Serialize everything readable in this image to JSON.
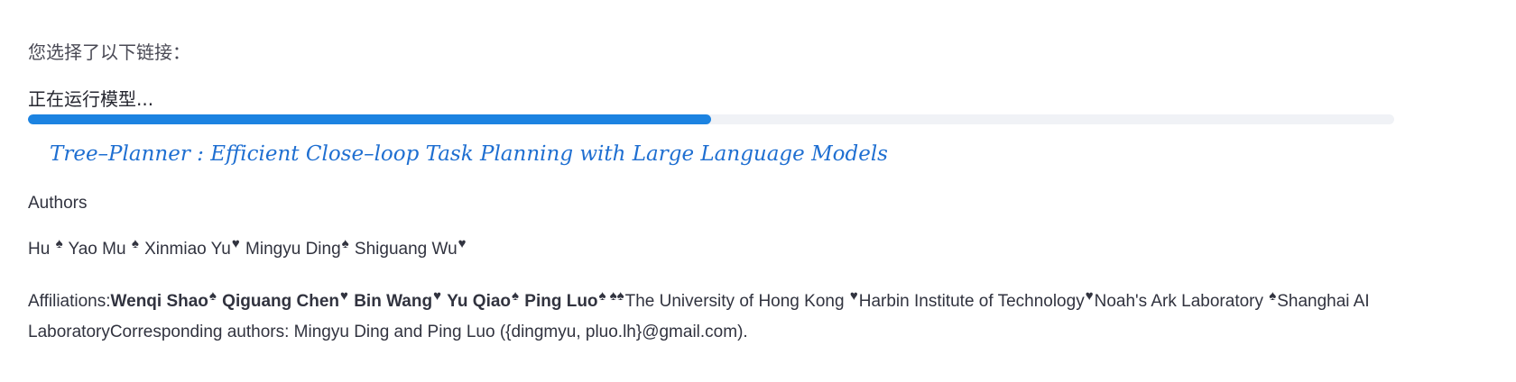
{
  "prompt": "您选择了以下链接：",
  "status": "正在运行模型...",
  "progress": {
    "fraction": 0.5,
    "color": "#1c83e1",
    "track_color": "#f0f2f6"
  },
  "paper": {
    "title": "Tree–Planner :  Efficient Close–loop Task Planning with Large Language Models",
    "title_color": "#1f6fd1"
  },
  "authors_heading": "Authors",
  "authors_line": [
    {
      "text": "Hu "
    },
    {
      "mark": "♠"
    },
    {
      "text": " Yao Mu "
    },
    {
      "mark": "♠"
    },
    {
      "text": " Xinmiao Yu"
    },
    {
      "mark": "♥"
    },
    {
      "text": " Mingyu Ding"
    },
    {
      "mark": "♠"
    },
    {
      "text": " Shiguang Wu"
    },
    {
      "mark": "♥"
    }
  ],
  "affiliations": {
    "label": "Affiliations:",
    "names": [
      {
        "name": "Wenqi Shao",
        "mark": "♠"
      },
      {
        "name": "Qiguang Chen",
        "mark": "♥"
      },
      {
        "name": "Bin Wang",
        "mark": "♥"
      },
      {
        "name": "Yu Qiao",
        "mark": "♠"
      },
      {
        "name": "Ping Luo",
        "mark": "♠ ♠♠"
      }
    ],
    "institutions": [
      {
        "text": "The University of Hong Kong ",
        "mark": "♥"
      },
      {
        "text": "Harbin Institute of Technology",
        "mark": "♥"
      },
      {
        "text": "Noah's Ark Laboratory ",
        "mark": "♠"
      },
      {
        "text": "Shanghai AI LaboratoryCorresponding authors: Mingyu Ding and Ping Luo ({dingmyu, pluo.lh}@gmail.com)."
      }
    ]
  }
}
